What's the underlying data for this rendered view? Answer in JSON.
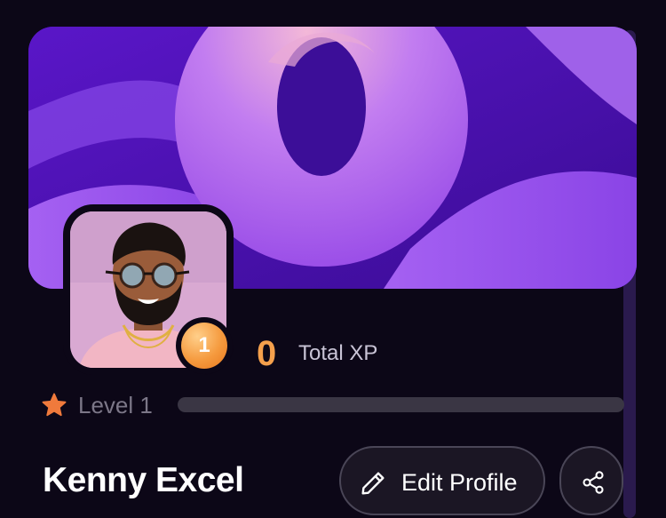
{
  "profile": {
    "name": "Kenny Excel",
    "level_badge": "1",
    "level_label": "Level 1",
    "level_progress": 0,
    "xp_value": "0",
    "xp_label": "Total XP"
  },
  "actions": {
    "edit_label": "Edit Profile",
    "edit_icon": "pencil-icon",
    "share_icon": "share-icon"
  },
  "level_icon": "star-icon",
  "colors": {
    "background": "#0c0717",
    "accent_orange": "#f5a04c",
    "banner_purple": "#9b5cf0",
    "progress_track": "#3a3644"
  }
}
